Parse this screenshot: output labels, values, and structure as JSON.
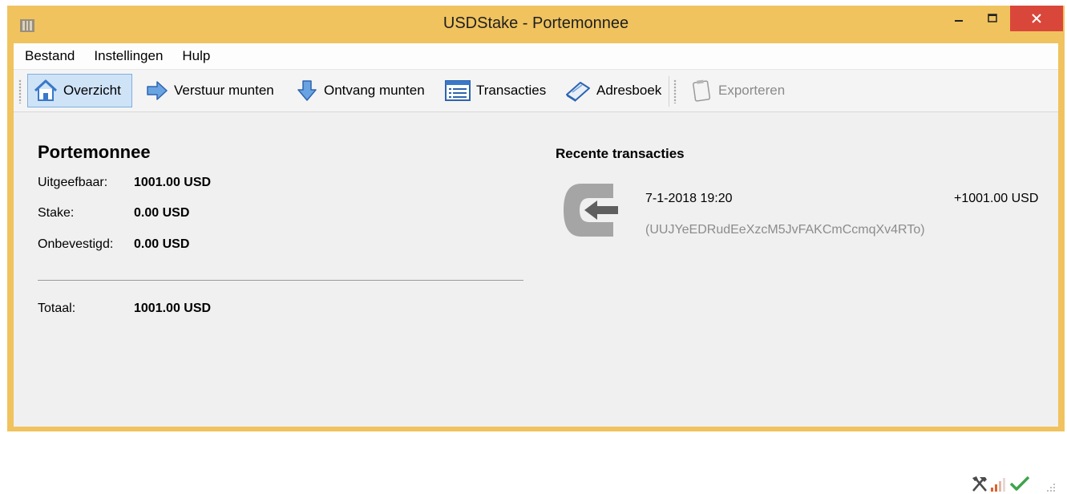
{
  "window": {
    "title": "USDStake - Portemonnee",
    "controls": {
      "minimize": "minimize-icon",
      "maximize": "maximize-icon",
      "close": "close-icon"
    }
  },
  "menu": [
    {
      "label": "Bestand"
    },
    {
      "label": "Instellingen"
    },
    {
      "label": "Hulp"
    }
  ],
  "toolbar": {
    "overview": "Overzicht",
    "send": "Verstuur munten",
    "receive": "Ontvang munten",
    "transactions": "Transacties",
    "addressbook": "Adresboek",
    "export": "Exporteren"
  },
  "wallet": {
    "title": "Portemonnee",
    "rows": [
      {
        "label": "Uitgeefbaar:",
        "value": "1001.00 USD"
      },
      {
        "label": "Stake:",
        "value": "0.00 USD"
      },
      {
        "label": "Onbevestigd:",
        "value": "0.00 USD"
      }
    ],
    "total_label": "Totaal:",
    "total_value": "1001.00 USD"
  },
  "recent": {
    "title": "Recente transacties",
    "items": [
      {
        "date": "7-1-2018 19:20",
        "amount": "+1001.00 USD",
        "address": "(UUJYeEDRudEeXzcM5JvFAKCmCcmqXv4RTo)"
      }
    ]
  },
  "colors": {
    "titlebar": "#f0c35f",
    "close": "#d9473a",
    "active_tab": "#cfe3f7",
    "address_text": "#8c8c8c"
  },
  "status": {
    "icons": [
      "staking-hammer-icon",
      "signal-bars-icon",
      "synced-check-icon"
    ]
  }
}
